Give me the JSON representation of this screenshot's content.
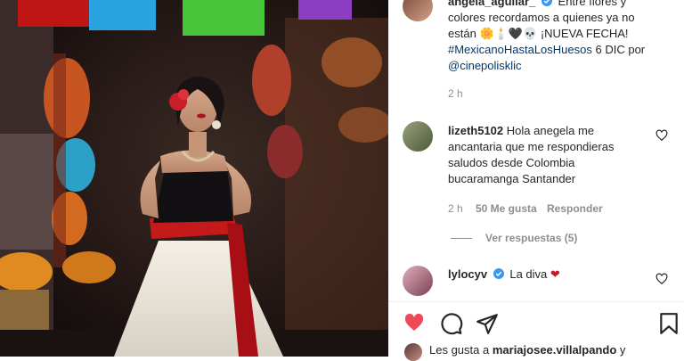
{
  "caption": {
    "username": "angela_aguilar_",
    "line1": "Entre flores y",
    "line2": "colores recordamos a quienes ya no",
    "line3_pre": "están",
    "line3_emoji": "🌼🕯️🖤💀",
    "line3_post": "¡NUEVA FECHA!",
    "hashtag": "#MexicanoHastaLosHuesos",
    "line4_post": "6 DIC por",
    "mention": "@cinepolisklic",
    "time": "2 h"
  },
  "comments": [
    {
      "username": "lizeth5102",
      "text_line1": "Hola anegela me",
      "text_line2": "ancantaria que me respondieras",
      "text_line3": "saludos desde Colombia",
      "text_line4": "bucaramanga Santander",
      "time": "2 h",
      "likes": "50 Me gusta",
      "reply": "Responder",
      "view_replies": "Ver respuestas (5)"
    },
    {
      "username": "lylocyv",
      "text": "La diva",
      "emoji": "❤"
    }
  ],
  "likes_line": {
    "pre": "Les gusta a",
    "user": "mariajosee.villalpando",
    "post": "y"
  },
  "colors": {
    "verified": "#3897f0",
    "like_red": "#ed4956"
  }
}
